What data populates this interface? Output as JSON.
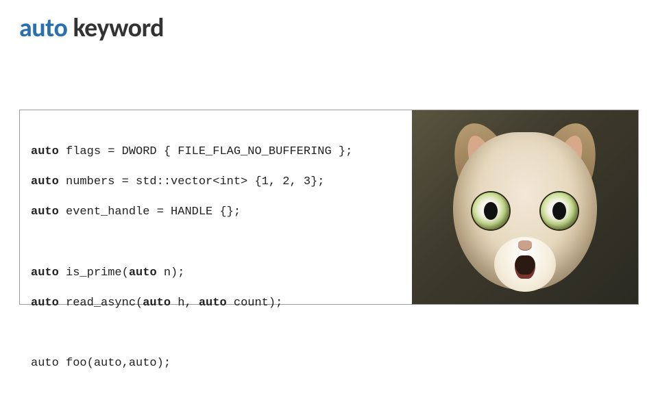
{
  "title": {
    "accent": "auto",
    "rest": " keyword"
  },
  "code": {
    "l1": {
      "kw": "auto",
      "rest": " flags = DWORD { FILE_FLAG_NO_BUFFERING };"
    },
    "l2": {
      "kw": "auto",
      "rest": " numbers = std::vector<int> {1, 2, 3};"
    },
    "l3": {
      "kw": "auto",
      "rest": " event_handle = HANDLE {};"
    },
    "l4a": {
      "kw": "auto",
      "rest1": " is_prime(",
      "kw2": "auto",
      "rest2": " n);"
    },
    "l5a": {
      "kw": "auto",
      "rest1": " read_async(",
      "kw2": "auto",
      "rest2": " h, ",
      "kw3": "auto",
      "rest3": " count);"
    },
    "l6": "auto foo(auto,auto);"
  },
  "image": {
    "alt": "shocked-cat-photo"
  }
}
